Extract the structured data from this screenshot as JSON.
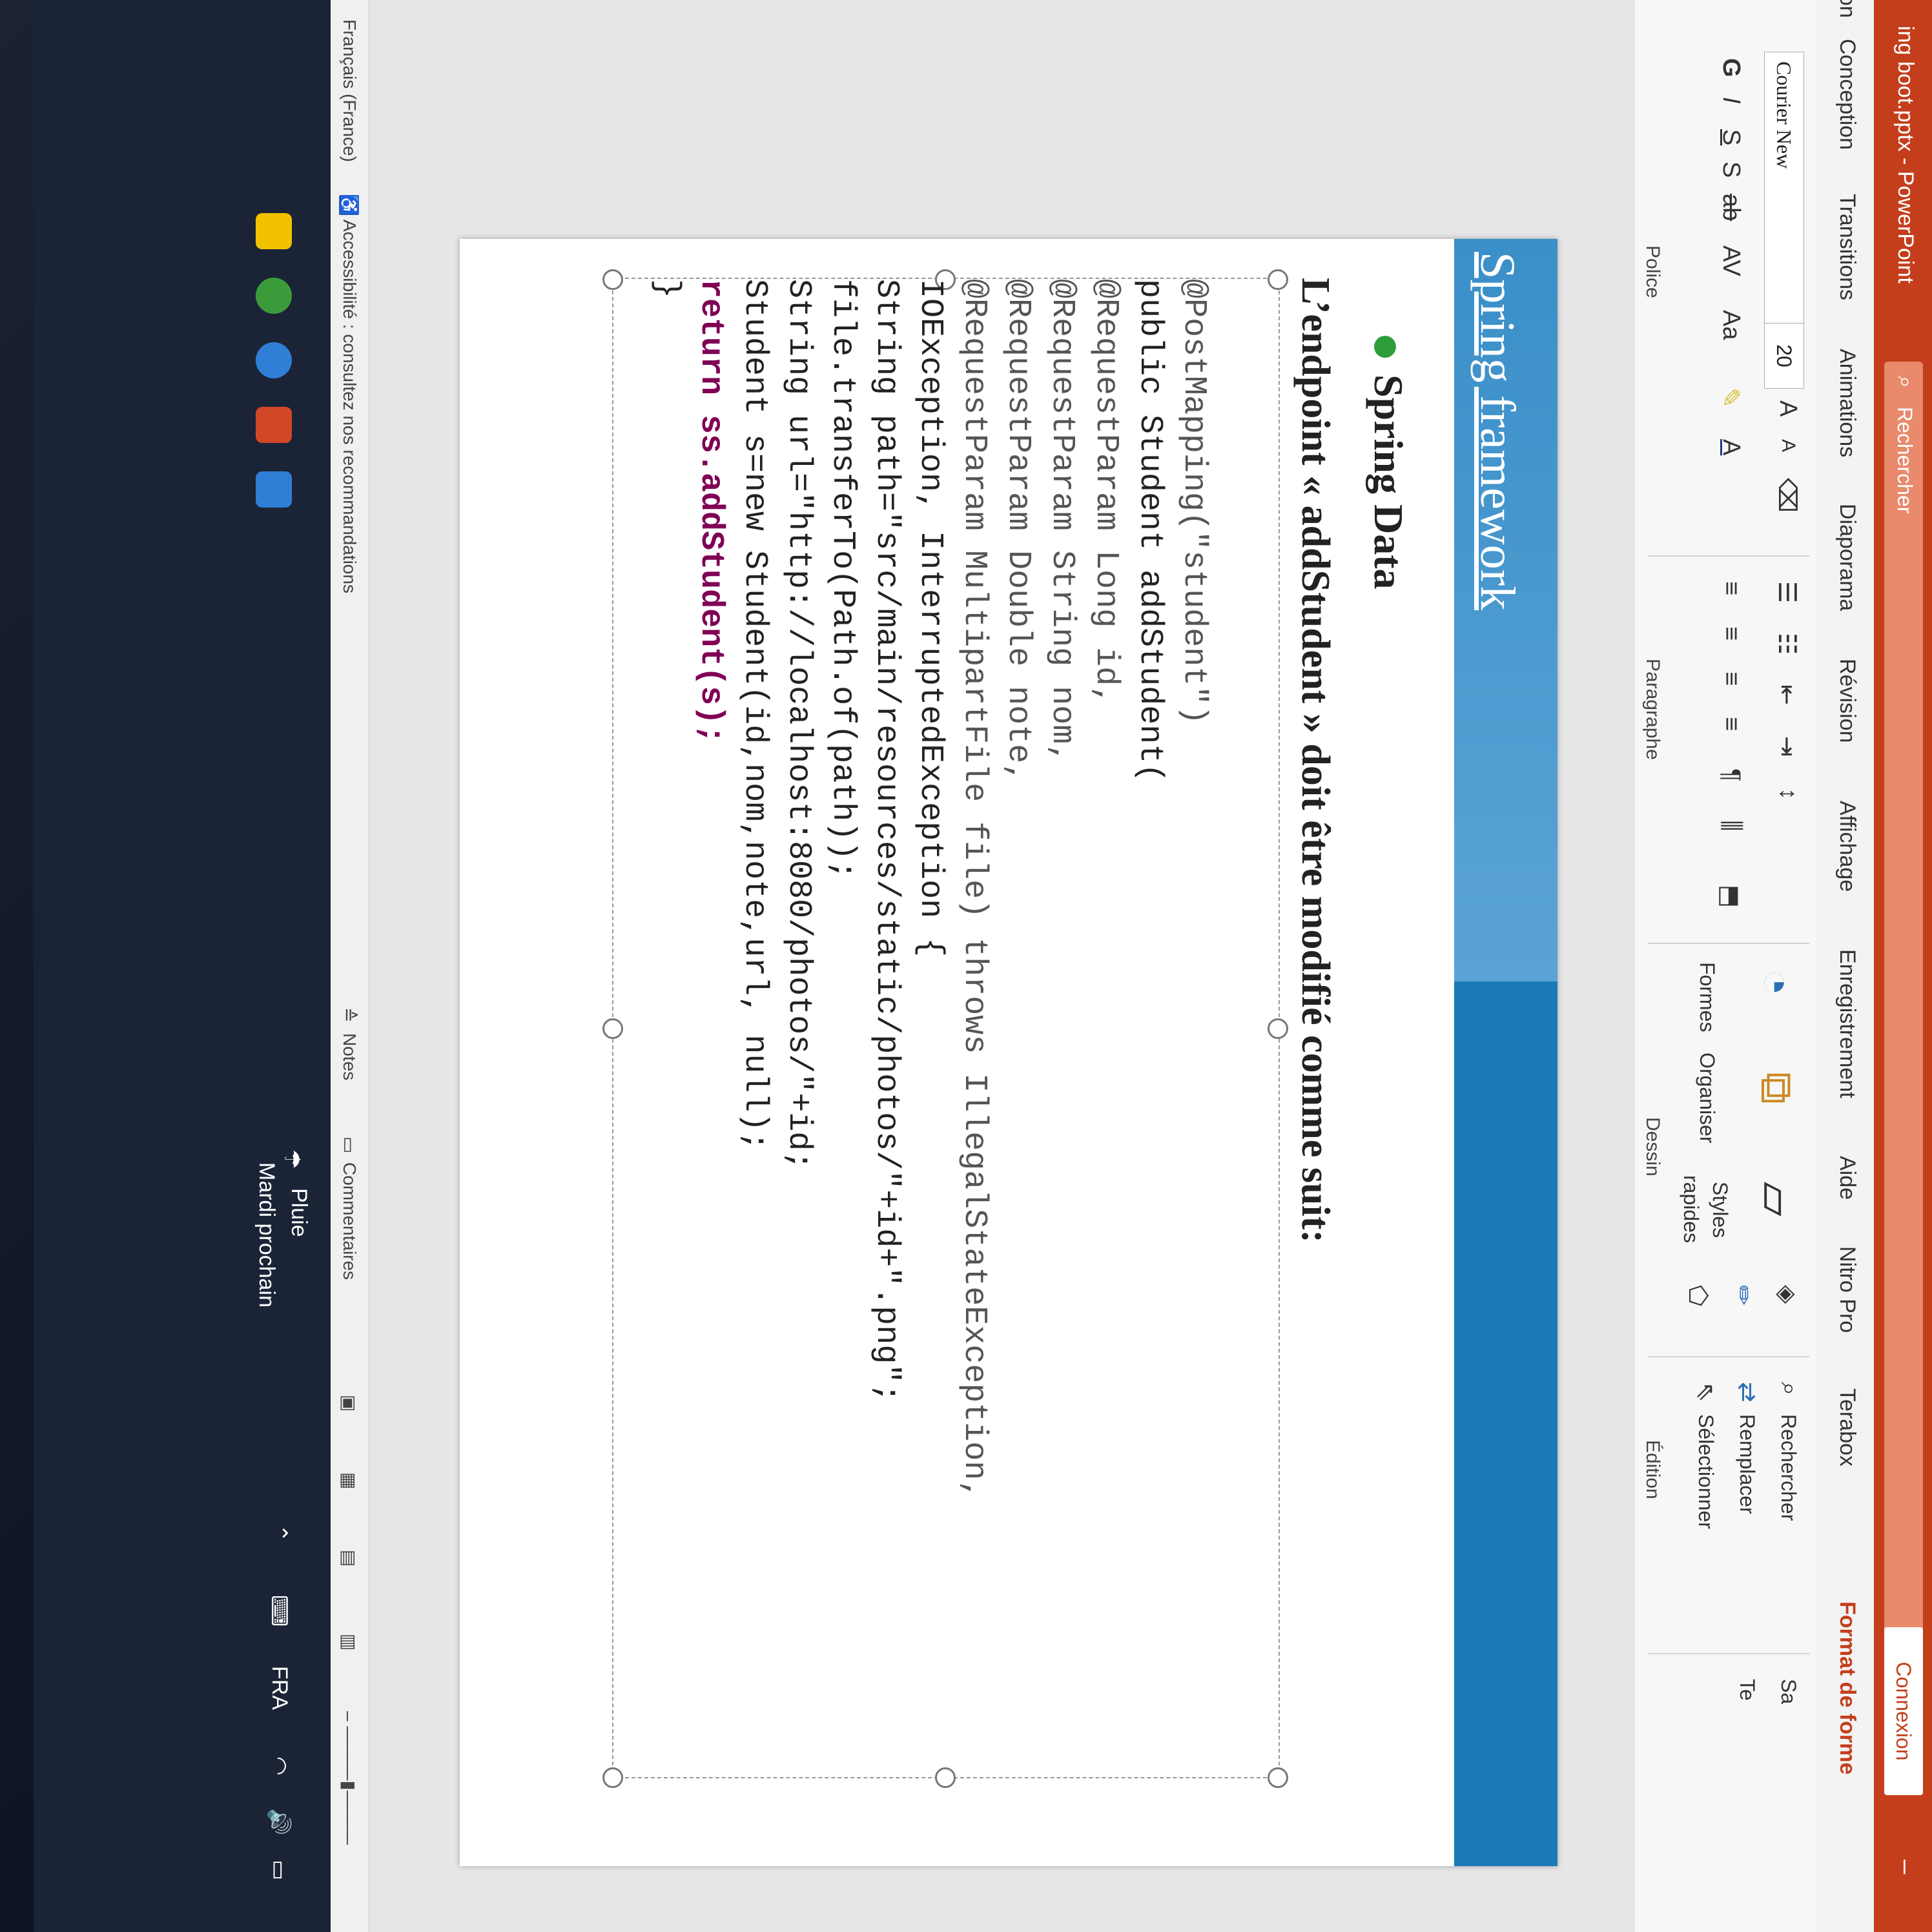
{
  "app": {
    "title": "ing boot.pptx - PowerPoint",
    "search_label": "Rechercher",
    "connexion_label": "Connexion",
    "minimize_label": "–"
  },
  "tabs": [
    "Conception",
    "Transitions",
    "Animations",
    "Diaporama",
    "Révision",
    "Affichage",
    "Enregistrement",
    "Aide",
    "Nitro Pro",
    "Terabox"
  ],
  "tab_active": "Format de forme",
  "tab_partial": "on",
  "ribbon": {
    "font_name": "Courier New",
    "font_size": "20",
    "police_label": "Police",
    "paragraphe_label": "Paragraphe",
    "dessin_label": "Dessin",
    "edition_label": "Édition",
    "formes_label": "Formes",
    "organiser_label": "Organiser",
    "styles_label": "Styles",
    "rapides_label": "rapides",
    "rechercher_label": "Rechercher",
    "remplacer_label": "Remplacer",
    "selectionner_label": "Sélectionner",
    "format_bold": "G",
    "format_italic": "I",
    "format_underline": "S",
    "format_shadow": "S",
    "format_strike": "ab",
    "char_spacing": "AV",
    "change_case": "Aa",
    "grow_font": "A",
    "shrink_font": "A",
    "edge_sa": "Sa",
    "edge_te": "Te"
  },
  "slide": {
    "title": "Spring framework",
    "bullet": "Spring Data",
    "heading": "L’endpoint « addStudent » doit être modifié comme suit:",
    "code_lines": [
      "@PostMapping(\"student\")",
      "public Student addStudent(",
      "@RequestParam Long id,",
      "@RequestParam String nom,",
      "@RequestParam Double note,",
      "@RequestParam MultipartFile file) throws IllegalStateException,",
      "IOException, InterruptedException {",
      "String path=\"src/main/resources/static/photos/\"+id+\".png\";",
      "file.transferTo(Path.of(path));",
      "String url=\"http://localhost:8080/photos/\"+id;",
      "Student s=new Student(id,nom,note,url, null);",
      "return ss.addStudent(s);",
      "}"
    ]
  },
  "statusbar": {
    "language": "Français (France)",
    "accessibility": "Accessibilité : consultez nos recommandations",
    "notes": "Notes",
    "comments": "Commentaires"
  },
  "taskbar": {
    "weather_title": "Pluie",
    "weather_sub": "Mardi prochain",
    "lang": "FRA"
  }
}
